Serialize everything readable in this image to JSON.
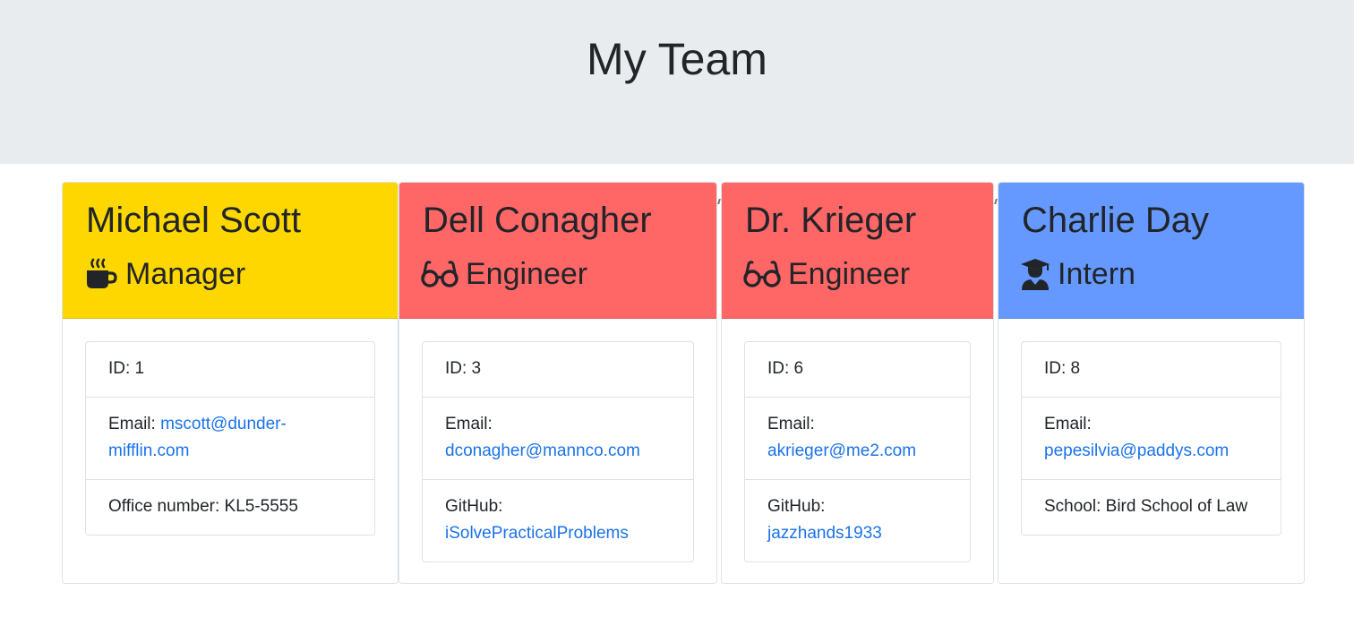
{
  "header": {
    "title": "My Team"
  },
  "colors": {
    "manager": "#ffd700",
    "engineer": "#ff6666",
    "intern": "#6699ff",
    "link": "#1a73e8"
  },
  "team": [
    {
      "name": "Michael Scott",
      "role": "Manager",
      "icon": "coffee-mug-icon",
      "id_label": "ID: 1",
      "email_label": "Email: ",
      "email": "mscott@dunder-mifflin.com",
      "extra_label": "Office number: KL5-5555",
      "extra_value": ""
    },
    {
      "name": "Dell Conagher",
      "role": "Engineer",
      "icon": "glasses-icon",
      "id_label": "ID: 3",
      "email_label": "Email: ",
      "email": "dconagher@mannco.com",
      "extra_label": "GitHub: ",
      "extra_value": "iSolvePracticalProblems"
    },
    {
      "name": "Dr. Krieger",
      "role": "Engineer",
      "icon": "glasses-icon",
      "id_label": "ID: 6",
      "email_label": "Email: ",
      "email": "akrieger@me2.com",
      "extra_label": "GitHub: ",
      "extra_value": "jazzhands1933"
    },
    {
      "name": "Charlie Day",
      "role": "Intern",
      "icon": "graduate-icon",
      "id_label": "ID: 8",
      "email_label": "Email: ",
      "email": "pepesilvia@paddys.com",
      "extra_label": "School: Bird School of Law",
      "extra_value": ""
    }
  ]
}
